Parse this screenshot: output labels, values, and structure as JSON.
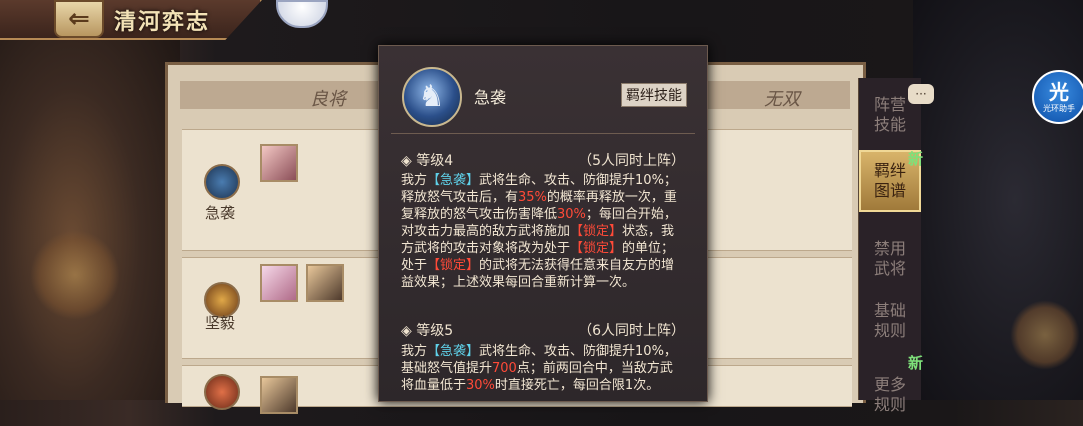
{
  "header": {
    "back_icon": "back-arrow-icon",
    "back_glyph": "⇐",
    "title": "清河弈志"
  },
  "panel": {
    "col_left": "良将",
    "col_right": "无双",
    "rows": [
      {
        "label": "急袭"
      },
      {
        "label": "坚毅"
      },
      {
        "label": ""
      }
    ]
  },
  "sidebar": {
    "items": [
      {
        "label": "阵营\n技能"
      },
      {
        "label": "羁绊\n图谱"
      },
      {
        "label": "禁用\n武将"
      },
      {
        "label": "基础\n规则"
      },
      {
        "label": "更多\n规则"
      }
    ],
    "new_label": "新"
  },
  "chat": {
    "glyph": "···"
  },
  "helper": {
    "big": "光",
    "small": "光环助手"
  },
  "popup": {
    "skill_name": "急袭",
    "bond_button": "羁绊技能",
    "levels": [
      {
        "level": "◈ 等级4",
        "condition": "（5人同时上阵）",
        "segments": [
          {
            "t": "我方",
            "c": ""
          },
          {
            "t": "【急袭】",
            "c": "blue"
          },
          {
            "t": "武将生命、攻击、防御提升10%；释放怒气攻击后，有",
            "c": ""
          },
          {
            "t": "35%",
            "c": "red"
          },
          {
            "t": "的概率再释放一次，重复释放的怒气攻击伤害降低",
            "c": ""
          },
          {
            "t": "30%",
            "c": "red"
          },
          {
            "t": "；每回合开始，对攻击力最高的敌方武将施加",
            "c": ""
          },
          {
            "t": "【锁定】",
            "c": "red"
          },
          {
            "t": "状态，我方武将的攻击对象将改为处于",
            "c": ""
          },
          {
            "t": "【锁定】",
            "c": "red"
          },
          {
            "t": "的单位；处于",
            "c": ""
          },
          {
            "t": "【锁定】",
            "c": "red"
          },
          {
            "t": "的武将无法获得任意来自友方的增益效果；上述效果每回合重新计算一次。",
            "c": ""
          }
        ]
      },
      {
        "level": "◈ 等级5",
        "condition": "（6人同时上阵）",
        "segments": [
          {
            "t": "我方",
            "c": ""
          },
          {
            "t": "【急袭】",
            "c": "blue"
          },
          {
            "t": "武将生命、攻击、防御提升10%，基础怒气值提升",
            "c": ""
          },
          {
            "t": "700",
            "c": "red"
          },
          {
            "t": "点；前两回合中，当敌方武将血量低于",
            "c": ""
          },
          {
            "t": "30%",
            "c": "red"
          },
          {
            "t": "时直接死亡，每回合限1次。",
            "c": ""
          }
        ]
      }
    ]
  },
  "colors": {
    "accent_blue": "#5fd0e8",
    "accent_red": "#ff4a38",
    "new_green": "#7ee07a"
  }
}
